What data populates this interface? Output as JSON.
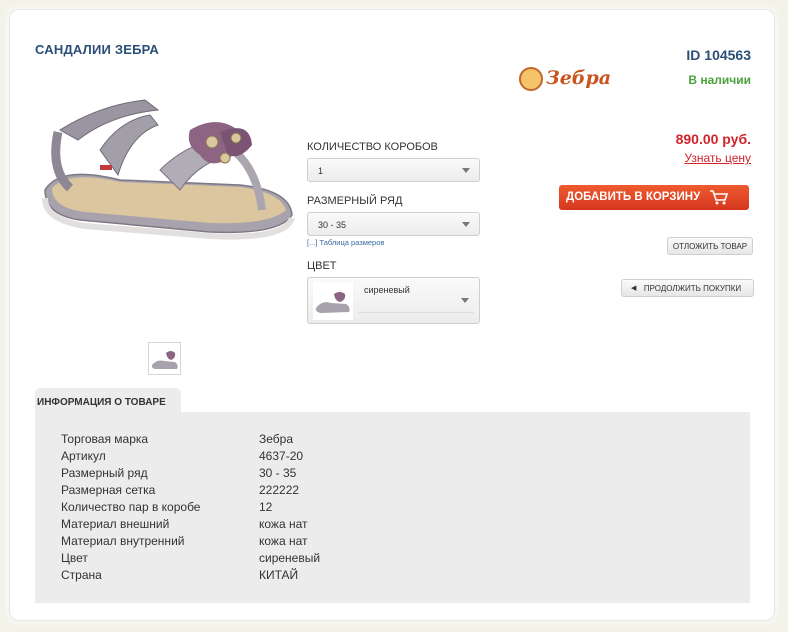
{
  "product": {
    "title": "САНДАЛИИ ЗЕБРА",
    "id_label": "ID 104563",
    "brand_logo_text": "Зебра",
    "availability": "В наличии",
    "price": "890.00 руб.",
    "ask_price": "Узнать цену"
  },
  "options": {
    "boxes_label": "КОЛИЧЕСТВО КОРОБОВ",
    "boxes_value": "1",
    "size_label": "РАЗМЕРНЫЙ РЯД",
    "size_value": "30 - 35",
    "size_table_link": "[...] Таблица размеров",
    "color_label": "ЦВЕТ",
    "color_value": "сиреневый"
  },
  "actions": {
    "add_to_cart": "ДОБАВИТЬ В КОРЗИНУ",
    "postpone": "ОТЛОЖИТЬ ТОВАР",
    "continue": "ПРОДОЛЖИТЬ ПОКУПКИ"
  },
  "info": {
    "tab_label": "ИНФОРМАЦИЯ О ТОВАРЕ",
    "rows": [
      {
        "key": "Торговая марка",
        "value": "Зебра"
      },
      {
        "key": "Артикул",
        "value": "4637-20"
      },
      {
        "key": "Размерный ряд",
        "value": "30 - 35"
      },
      {
        "key": "Размерная сетка",
        "value": "222222"
      },
      {
        "key": "Количество пар в коробе",
        "value": "12"
      },
      {
        "key": "Материал внешний",
        "value": "кожа нат"
      },
      {
        "key": "Материал внутренний",
        "value": "кожа нат"
      },
      {
        "key": "Цвет",
        "value": "сиреневый"
      },
      {
        "key": "Страна",
        "value": "КИТАЙ"
      }
    ]
  },
  "icons": {
    "cart": "cart-icon",
    "caret": "chevron-down-icon",
    "back": "arrow-left-icon"
  },
  "colors": {
    "title": "#2b4f76",
    "available": "#4aa33b",
    "price": "#d0242b",
    "cart_button": "#e5472a"
  }
}
